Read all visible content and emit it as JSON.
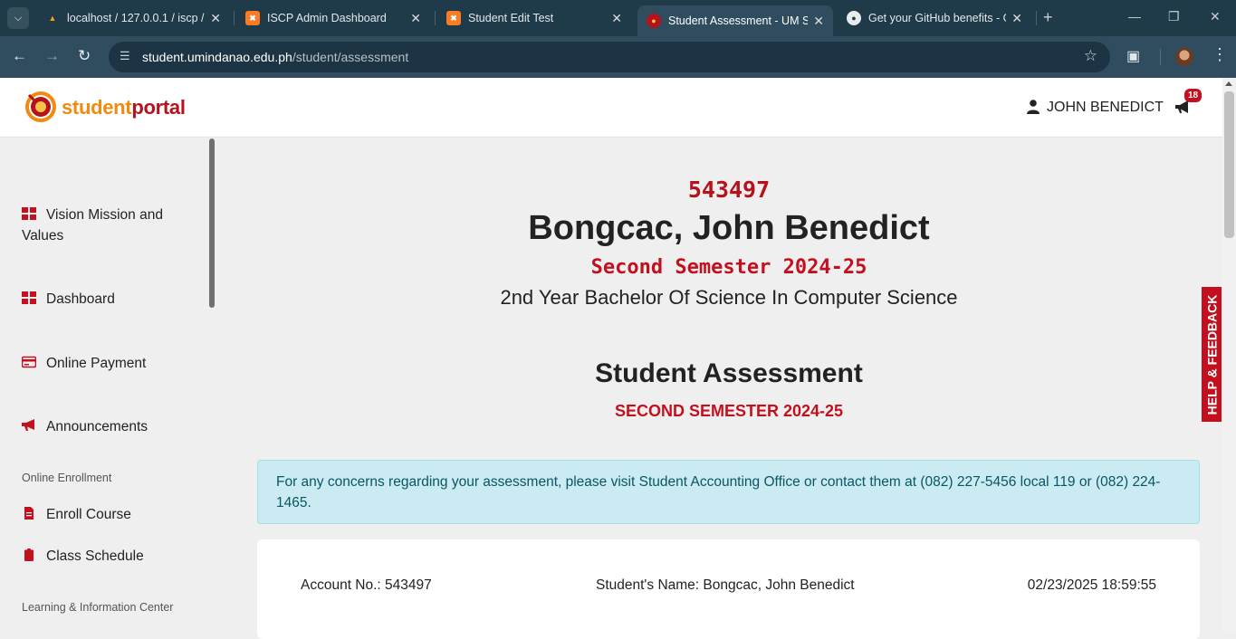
{
  "browser": {
    "tabs": [
      {
        "title": "localhost / 127.0.0.1 / iscp / ...",
        "favicon": "phpmyadmin-icon"
      },
      {
        "title": "ISCP Admin Dashboard",
        "favicon": "xampp-icon"
      },
      {
        "title": "Student Edit Test",
        "favicon": "xampp-icon"
      },
      {
        "title": "Student Assessment - UM ST...",
        "favicon": "um-seal-icon",
        "active": true
      },
      {
        "title": "Get your GitHub benefits - G...",
        "favicon": "github-icon"
      }
    ],
    "url_host": "student.umindanao.edu.ph",
    "url_path": "/student/assessment"
  },
  "header": {
    "logo_part1": "student",
    "logo_part2": "portal",
    "user_name": "JOHN BENEDICT",
    "notification_count": "18"
  },
  "sidebar": {
    "items": [
      {
        "label": "Vision Mission and Values",
        "icon": "grid-icon"
      },
      {
        "label": "Dashboard",
        "icon": "grid-icon"
      },
      {
        "label": "Online Payment",
        "icon": "credit-card-icon"
      },
      {
        "label": "Announcements",
        "icon": "megaphone-icon"
      },
      {
        "label": "Enroll Course",
        "icon": "document-icon"
      },
      {
        "label": "Class Schedule",
        "icon": "clipboard-icon"
      }
    ],
    "section_online_enrollment": "Online Enrollment",
    "section_learning": "Learning & Information Center"
  },
  "student": {
    "account_no": "543497",
    "name": "Bongcac, John Benedict",
    "semester": "Second Semester 2024-25",
    "program": "2nd Year Bachelor Of Science In Computer Science"
  },
  "assessment": {
    "title": "Student Assessment",
    "semester": "SECOND SEMESTER 2024-25",
    "notice": "For any concerns regarding your assessment, please visit Student Accounting Office or contact them at (082) 227-5456 local 119 or (082) 224-1465.",
    "account_label": "Account No.: 543497",
    "name_label": "Student's Name: Bongcac, John Benedict",
    "timestamp": "02/23/2025 18:59:55"
  },
  "help_feedback": "HELP & FEEDBACK",
  "colors": {
    "brand_red": "#c3101f",
    "brand_orange": "#f08a10",
    "browser_frame": "#1f3a49"
  }
}
